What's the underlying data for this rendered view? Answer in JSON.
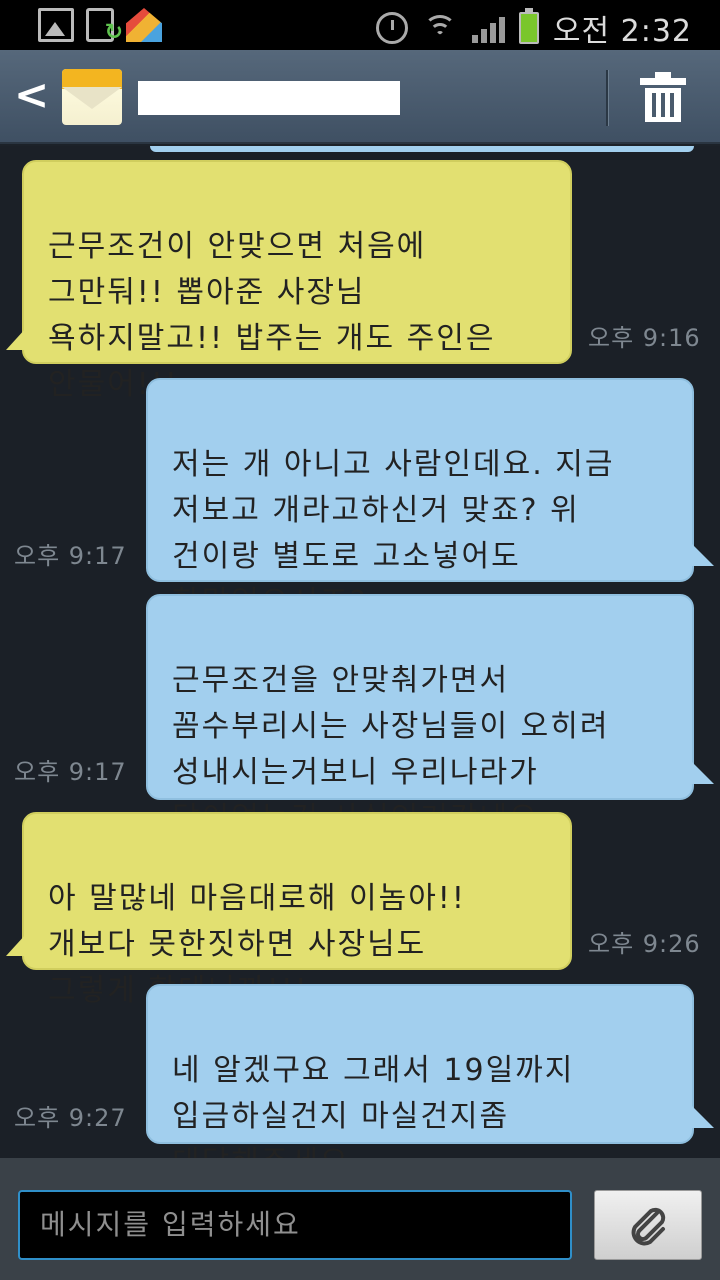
{
  "status_bar": {
    "time": "오전 2:32",
    "icons": [
      "gallery-icon",
      "upload-icon",
      "launcher-home-icon",
      "alarm-icon",
      "wifi-icon",
      "signal-icon",
      "battery-icon"
    ]
  },
  "header": {
    "back_icon": "chevron-left-icon",
    "thread_icon": "envelope-icon",
    "delete_icon": "trash-icon"
  },
  "messages": [
    {
      "direction": "incoming",
      "text": "근무조건이 안맞으면 처음에\n그만둬!! 뽑아준 사장님\n욕하지말고!! 밥주는 개도 주인은\n안물어!!!",
      "time": "오후 9:16"
    },
    {
      "direction": "outgoing",
      "text": "저는 개 아니고 사람인데요. 지금\n저보고 개라고하신거 맞죠? 위\n건이랑 별도로 고소넣어도\n할말없으시죠?",
      "time": "오후 9:17"
    },
    {
      "direction": "outgoing",
      "text": "근무조건을 안맞춰가면서\n꼼수부리시는 사장님들이 오히려\n성내시는거보니 우리나라가\n답이없는건 사실인거같네요",
      "time": "오후 9:17"
    },
    {
      "direction": "incoming",
      "text": "아 말많네 마음대로해 이놈아!!\n개보다 못한짓하면 사장님도\n그렇게 할테니까!!!",
      "time": "오후 9:26"
    },
    {
      "direction": "outgoing",
      "text": "네 알겠구요 그래서 19일까지\n입금하실건지 마실건지좀\n대답해주세요.",
      "time": "오후 9:27"
    }
  ],
  "composer": {
    "placeholder": "메시지를 입력하세요",
    "attach_icon": "paperclip-icon"
  },
  "colors": {
    "incoming_bubble": "#e2e071",
    "outgoing_bubble": "#a2cfee",
    "input_focus": "#2f8fc9"
  }
}
